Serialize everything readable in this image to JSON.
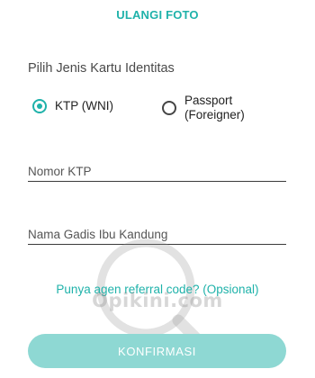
{
  "header": {
    "retake_label": "ULANGI FOTO"
  },
  "id_type": {
    "title": "Pilih Jenis Kartu Identitas",
    "options": [
      {
        "label": "KTP (WNI)",
        "selected": true
      },
      {
        "label_line1": "Passport",
        "label_line2": "(Foreigner)",
        "selected": false
      }
    ]
  },
  "form": {
    "ktp_number_placeholder": "Nomor KTP",
    "ktp_number_value": "",
    "mother_name_placeholder": "Nama Gadis Ibu Kandung",
    "mother_name_value": ""
  },
  "referral": {
    "label": "Punya agen referral code? (Opsional)"
  },
  "watermark": {
    "text": "Opikini.com"
  },
  "actions": {
    "confirm_label": "KONFIRMASI"
  },
  "colors": {
    "accent": "#1fb2aa",
    "button_disabled": "#8ed8d3"
  }
}
